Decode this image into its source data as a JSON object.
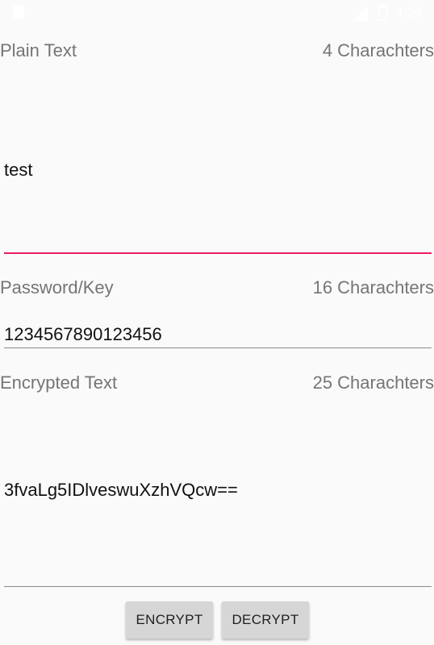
{
  "status_bar": {
    "time": "4:25",
    "icons": [
      "sim-card-icon",
      "signal-icon",
      "battery-icon"
    ]
  },
  "plain_text": {
    "label": "Plain Text",
    "count": "4 Charachters",
    "value": "test",
    "accent_color": "#e91e63"
  },
  "password": {
    "label": "Password/Key",
    "count": "16 Charachters",
    "value": "1234567890123456"
  },
  "encrypted": {
    "label": "Encrypted Text",
    "count": "25 Charachters",
    "value": "3fvaLg5IDlveswuXzhVQcw=="
  },
  "buttons": {
    "encrypt": "ENCRYPT",
    "decrypt": "DECRYPT"
  }
}
